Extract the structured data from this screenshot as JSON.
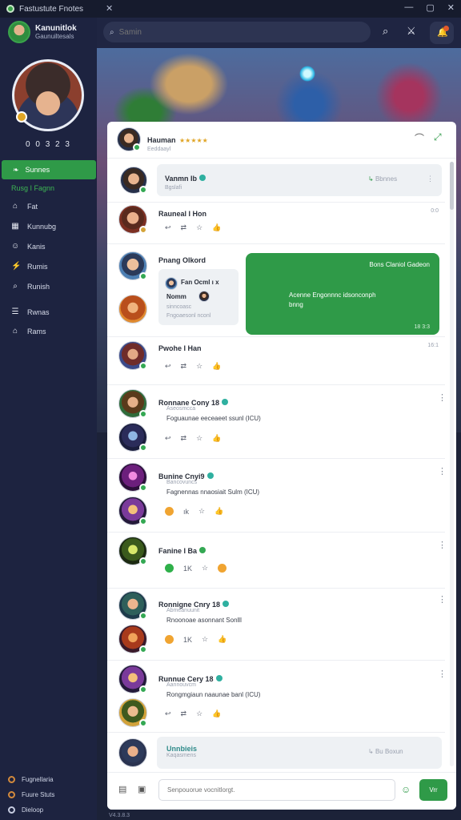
{
  "titlebar": {
    "title": "Fastustute Fnotes",
    "close_glyph": "✕",
    "controls": [
      "—",
      "▢",
      "✕"
    ]
  },
  "profile": {
    "name": "Kanunitlok",
    "subtitle": "Gaunuiltesals",
    "stats": "0 0 3 2 3"
  },
  "nav": {
    "active": "Sunnes",
    "section": "Rusg I Fagnn",
    "items": [
      {
        "icon": "home-icon",
        "glyph": "⌂",
        "label": "Fat"
      },
      {
        "icon": "grid-icon",
        "glyph": "▦",
        "label": "Kunnubg"
      },
      {
        "icon": "people-icon",
        "glyph": "☺",
        "label": "Kanis"
      },
      {
        "icon": "bolt-icon",
        "glyph": "⚡",
        "label": "Rumis"
      },
      {
        "icon": "search-icon",
        "glyph": "⌕",
        "label": "Runish"
      },
      {
        "icon": "list-icon",
        "glyph": "☰",
        "label": "Rwnas"
      },
      {
        "icon": "house-icon",
        "glyph": "⌂",
        "label": "Rams"
      }
    ],
    "footer": [
      "Fugnellaria",
      "Fuure Stuts",
      "Dieloop"
    ]
  },
  "search": {
    "placeholder": "Samin"
  },
  "chat_header": {
    "name": "Hauman",
    "stars": "★★★★★",
    "status": "Eeddaayl"
  },
  "messages": {
    "m1": {
      "name": "Vanmn Ib",
      "sub": "Bgslafi",
      "action": "Bbnnes"
    },
    "m2": {
      "name": "Rauneal I Hon",
      "time": "0:0"
    },
    "m3": {
      "name": "Pnang Olkord",
      "card_title": "Fan Ocml ı x",
      "card_name": "Nomm",
      "card_meta": "sinncoasc",
      "card_sub": "Fngoaesonl nconl",
      "green_title": "Bons Claniol Gadeon",
      "green_body": "Acenne Engonnnc idsonconph",
      "green_foot": "bnng",
      "green_time": "18 3:3"
    },
    "m4": {
      "name": "Pwohe I Han",
      "time": "16:1"
    },
    "m5": {
      "name": "Ronnane Cony 18",
      "sub": "Aseosmcca",
      "body": "Foguaunae eeceaeet ssunl (ICU)"
    },
    "m6": {
      "name": "Bunine Cnyi9",
      "sub": "Bancovuncs",
      "body": "Fagnennas nnaosiait Sulm (ICU)"
    },
    "m7": {
      "name": "Fanine I Ba",
      "count": "1K"
    },
    "m8": {
      "name": "Ronnigne Cnry 18",
      "sub": "Abmeanuunit",
      "body": "Rnoonoae asonnant Sonlll"
    },
    "m9": {
      "name": "Runnue Cery 18",
      "sub": "Aannouvcm",
      "body": "Rongmgiaun naaunae banl (ICU)"
    },
    "m10": {
      "name": "Unnbieis",
      "sub": "Kaqasmens",
      "action": "Bu Boxun"
    },
    "reaction_counts": {
      "a": "ık",
      "b": "1K"
    }
  },
  "composer": {
    "placeholder": "Senpouorue vocnitlorgt.",
    "send": "Vrr"
  },
  "footer": {
    "version": "V4.3.8.3"
  },
  "colors": {
    "accent": "#2f9a48",
    "sidebar": "#1d2340",
    "panel": "#ffffff"
  }
}
